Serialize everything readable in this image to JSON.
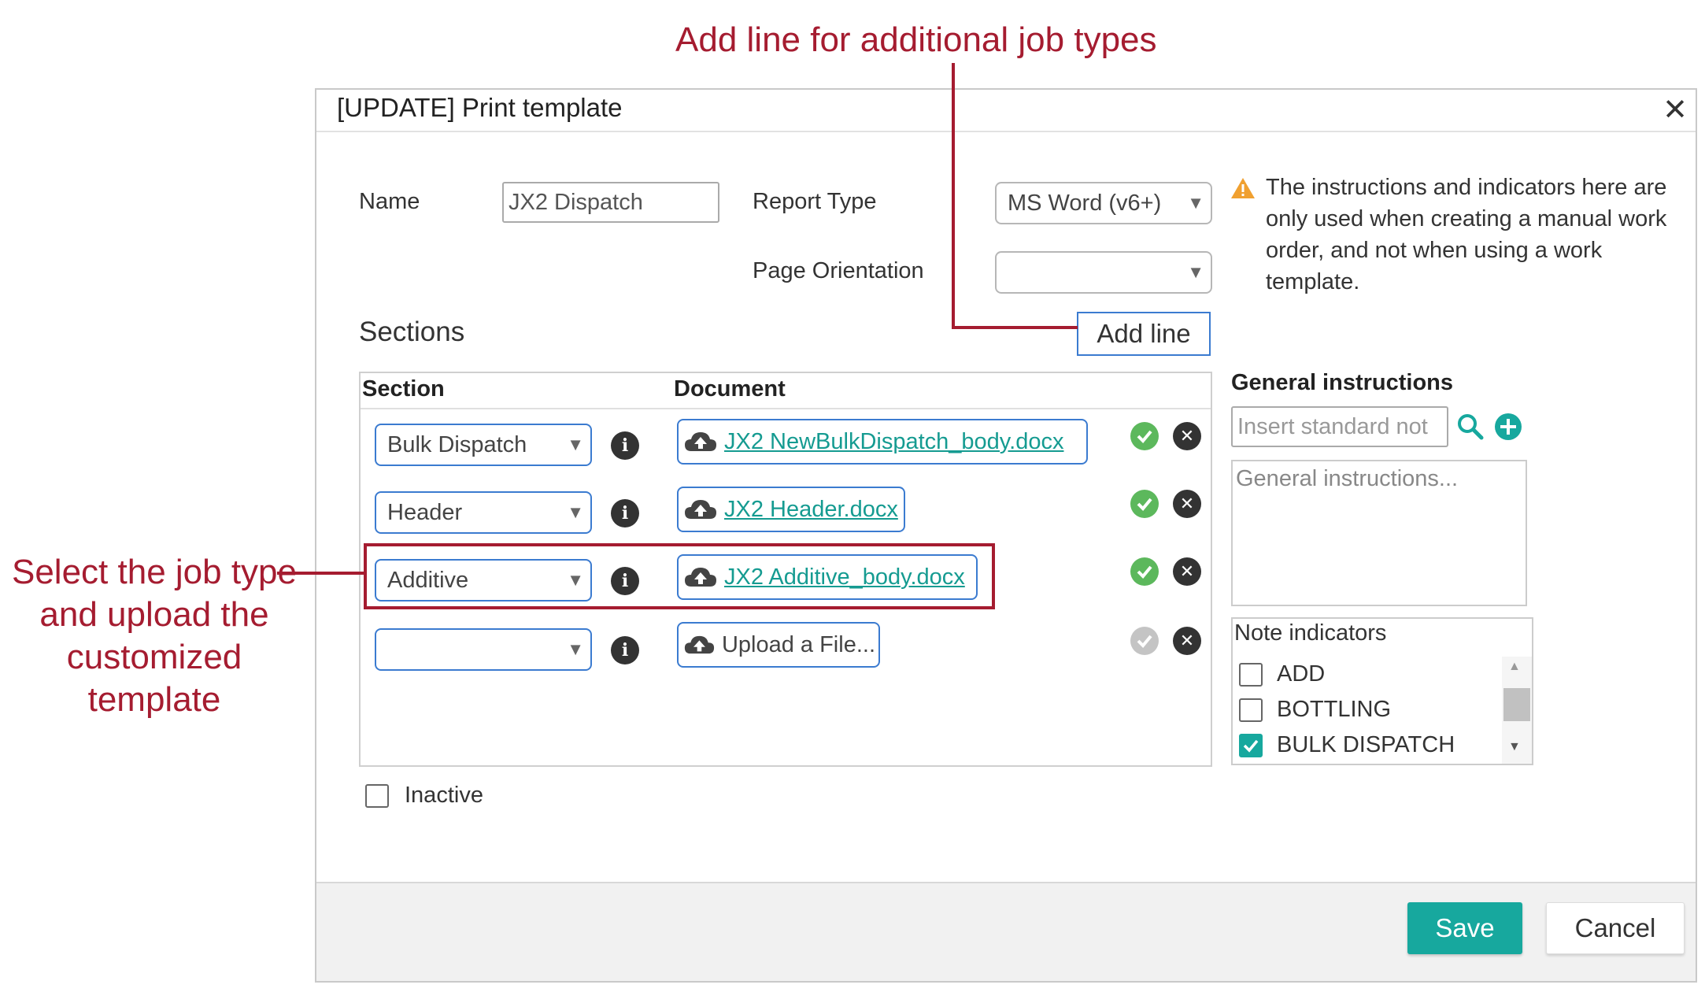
{
  "annotations": {
    "top": "Add line for additional job types",
    "left": "Select the job type and upload the customized template"
  },
  "dialog": {
    "title": "[UPDATE] Print template",
    "close_icon": "close-icon",
    "name_label": "Name",
    "name_value": "JX2 Dispatch",
    "report_type_label": "Report Type",
    "report_type_value": "MS Word (v6+)",
    "page_orientation_label": "Page Orientation",
    "page_orientation_value": "",
    "warning_text": "The instructions and indicators here are only used when creating a manual work order, and not when using a work template.",
    "sections_title": "Sections",
    "add_line_label": "Add line",
    "columns": {
      "section": "Section",
      "document": "Document"
    },
    "rows": [
      {
        "section": "Bulk Dispatch",
        "document": "JX2 NewBulkDispatch_body.docx",
        "uploaded": true
      },
      {
        "section": "Header",
        "document": "JX2 Header.docx",
        "uploaded": true
      },
      {
        "section": "Additive",
        "document": "JX2 Additive_body.docx",
        "uploaded": true
      },
      {
        "section": "",
        "document": "Upload a File...",
        "uploaded": false
      }
    ],
    "inactive_label": "Inactive",
    "general_instructions": {
      "title": "General instructions",
      "standard_note_placeholder": "Insert standard not",
      "textarea_placeholder": "General instructions..."
    },
    "note_indicators": {
      "title": "Note indicators",
      "items": [
        {
          "label": "ADD",
          "checked": false
        },
        {
          "label": "BOTTLING",
          "checked": false
        },
        {
          "label": "BULK DISPATCH",
          "checked": true
        }
      ]
    },
    "save_label": "Save",
    "cancel_label": "Cancel"
  },
  "colors": {
    "annotation": "#a51c30",
    "accent": "#17a89e",
    "link": "#159b91",
    "focus_border": "#3b7bd0",
    "ok_green": "#5cb85c"
  }
}
